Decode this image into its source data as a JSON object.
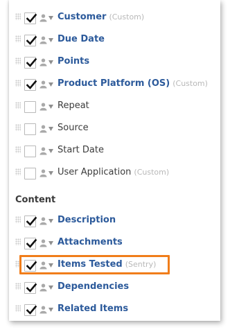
{
  "fields": [
    {
      "label": "Customer",
      "tag": "(Custom)",
      "checked": true
    },
    {
      "label": "Due Date",
      "tag": "",
      "checked": true
    },
    {
      "label": "Points",
      "tag": "",
      "checked": true
    },
    {
      "label": "Product Platform (OS)",
      "tag": "(Custom)",
      "checked": true
    },
    {
      "label": "Repeat",
      "tag": "",
      "checked": false
    },
    {
      "label": "Source",
      "tag": "",
      "checked": false
    },
    {
      "label": "Start Date",
      "tag": "",
      "checked": false
    },
    {
      "label": "User Application",
      "tag": "(Custom)",
      "checked": false
    }
  ],
  "content_section": {
    "title": "Content",
    "items": [
      {
        "label": "Description",
        "tag": "",
        "checked": true
      },
      {
        "label": "Attachments",
        "tag": "",
        "checked": true
      },
      {
        "label": "Items Tested",
        "tag": "(Sentry)",
        "checked": true,
        "highlighted": true
      },
      {
        "label": "Dependencies",
        "tag": "",
        "checked": true
      },
      {
        "label": "Related Items",
        "tag": "",
        "checked": true
      }
    ]
  },
  "colors": {
    "checked_label": "#2c5a9b",
    "unchecked_label": "#3c3c3c",
    "tag": "#b8b8b8",
    "highlight_border": "#f07d1a"
  },
  "icons": {
    "drag": "drag-handle-icon",
    "user": "user-icon",
    "dropdown": "chevron-down-icon",
    "check": "checkmark-icon"
  }
}
